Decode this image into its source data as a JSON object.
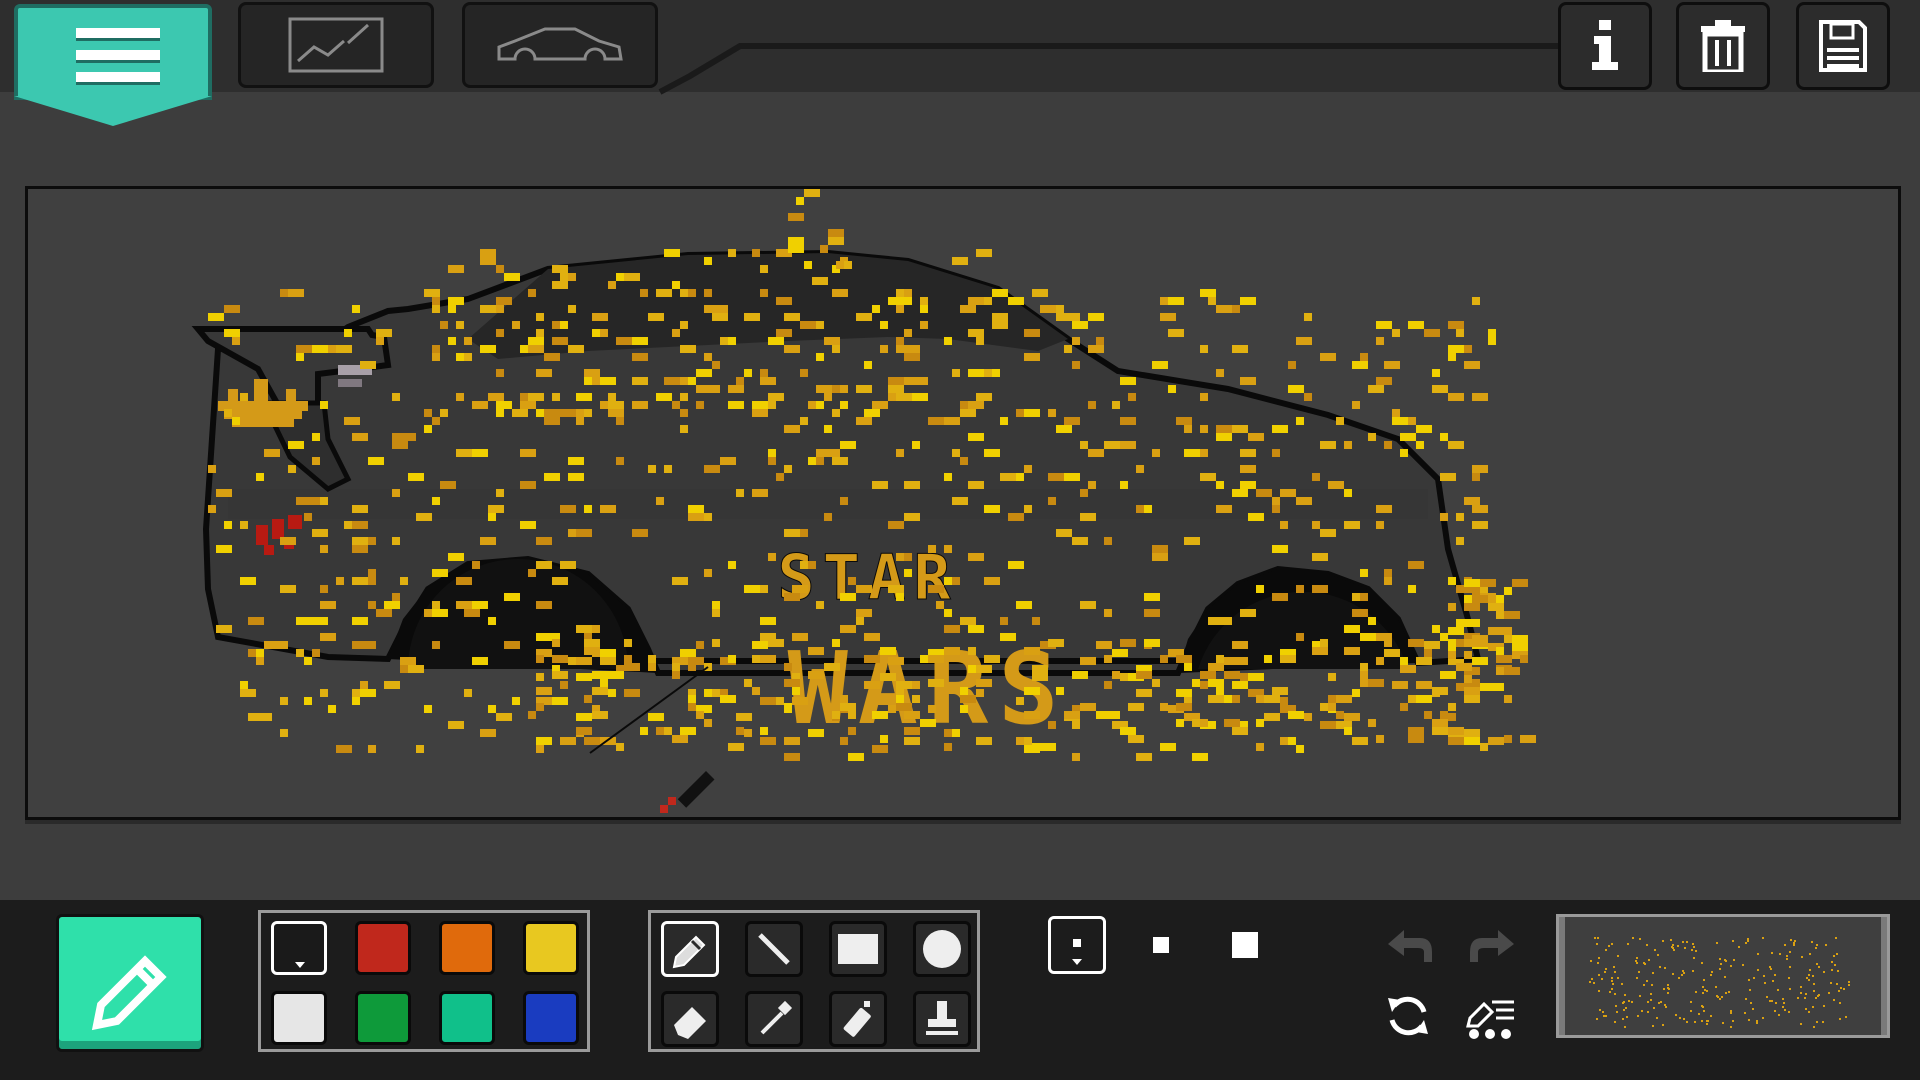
{
  "toolbar": {
    "menu_icon": "hamburger-menu-icon",
    "tab_drawing_icon": "drawing-canvas-icon",
    "tab_car_icon": "car-outline-icon",
    "info_icon": "info-icon",
    "delete_icon": "trash-icon",
    "save_icon": "floppy-disk-icon"
  },
  "canvas": {
    "text_line1": "STAR",
    "text_line2": "WARS",
    "background_color": "#404040",
    "car_color": "#3a3a3a",
    "paint_color": "#e0a010"
  },
  "palette": {
    "colors": [
      "#1a1a1a",
      "#c0281c",
      "#e06a0c",
      "#e8c820",
      "#e6e6e6",
      "#0e9a3a",
      "#10c08a",
      "#1a3cc0"
    ],
    "selected_index": 0
  },
  "tools": {
    "items": [
      "pencil-icon",
      "line-icon",
      "rectangle-icon",
      "circle-icon",
      "eraser-icon",
      "eyedropper-icon",
      "spray-can-icon",
      "stamp-icon"
    ],
    "selected_index": 0
  },
  "brush_sizes": {
    "items": [
      "small",
      "medium",
      "large"
    ],
    "selected_index": 0
  },
  "history": {
    "undo_icon": "undo-icon",
    "redo_icon": "redo-icon",
    "rotate_icon": "rotate-icon",
    "brush_settings_icon": "brush-settings-icon"
  },
  "minimap": {
    "label": "preview-thumbnail"
  }
}
